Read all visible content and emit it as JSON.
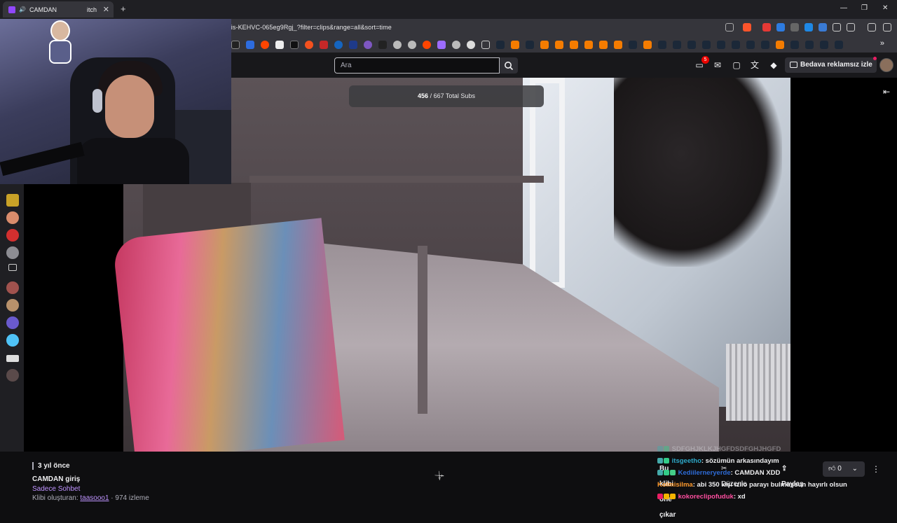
{
  "browser": {
    "tab_title": "CAMDAN - Twitch",
    "tab_title_visible": "CAMDAN ",
    "tab_title_suffix": "itch",
    "new_tab": "+",
    "url": "twitch.tv/kaijiri/clip/HonestFreezingMelonRiPepperonis-KEHVC-065eg9Rgj_?filter=clips&range=all&sort=time"
  },
  "topnav": {
    "search_placeholder": "Ara",
    "notification_count": "5",
    "ad_free_label": "Bedava reklamsız izle"
  },
  "video": {
    "subs_current": "456",
    "subs_rest": " / 667 Total Subs"
  },
  "clip": {
    "age": "3 yıl önce",
    "title": "CAMDAN giriş",
    "category": "Sadece Sohbet",
    "creator_prefix": "Klibi oluşturan: ",
    "creator": "taasooo1",
    "views": " · 974 izleme"
  },
  "actions": {
    "feature_label": "Bu klibi öne çıkar",
    "edit_label": "Düzenle",
    "share_label": "Paylaş",
    "like_count": "0"
  },
  "chat": [
    {
      "user": "",
      "user_color": "#2ea87a",
      "message": "SDFGHJKLKJHGFDSDFGHJHGFD"
    },
    {
      "user": "itsgeetho",
      "user_color": "#2ea8c8",
      "message": ": sözümün arkasındayım"
    },
    {
      "user": "Kediilerneryerde",
      "user_color": "#2e6bd6",
      "message": ": CAMDAN XDD"
    },
    {
      "user": "Kolmisilma",
      "user_color": "#ff9a2e",
      "message": ": abi 350 kişi izlio parayı bulmuşsun hayırlı olsun"
    },
    {
      "user": "kokoreclipofuduk",
      "user_color": "#ff4fa0",
      "message": ": xd"
    }
  ],
  "colors": {
    "accent": "#9147ff",
    "link": "#bf94ff",
    "notification": "#eb0400"
  }
}
